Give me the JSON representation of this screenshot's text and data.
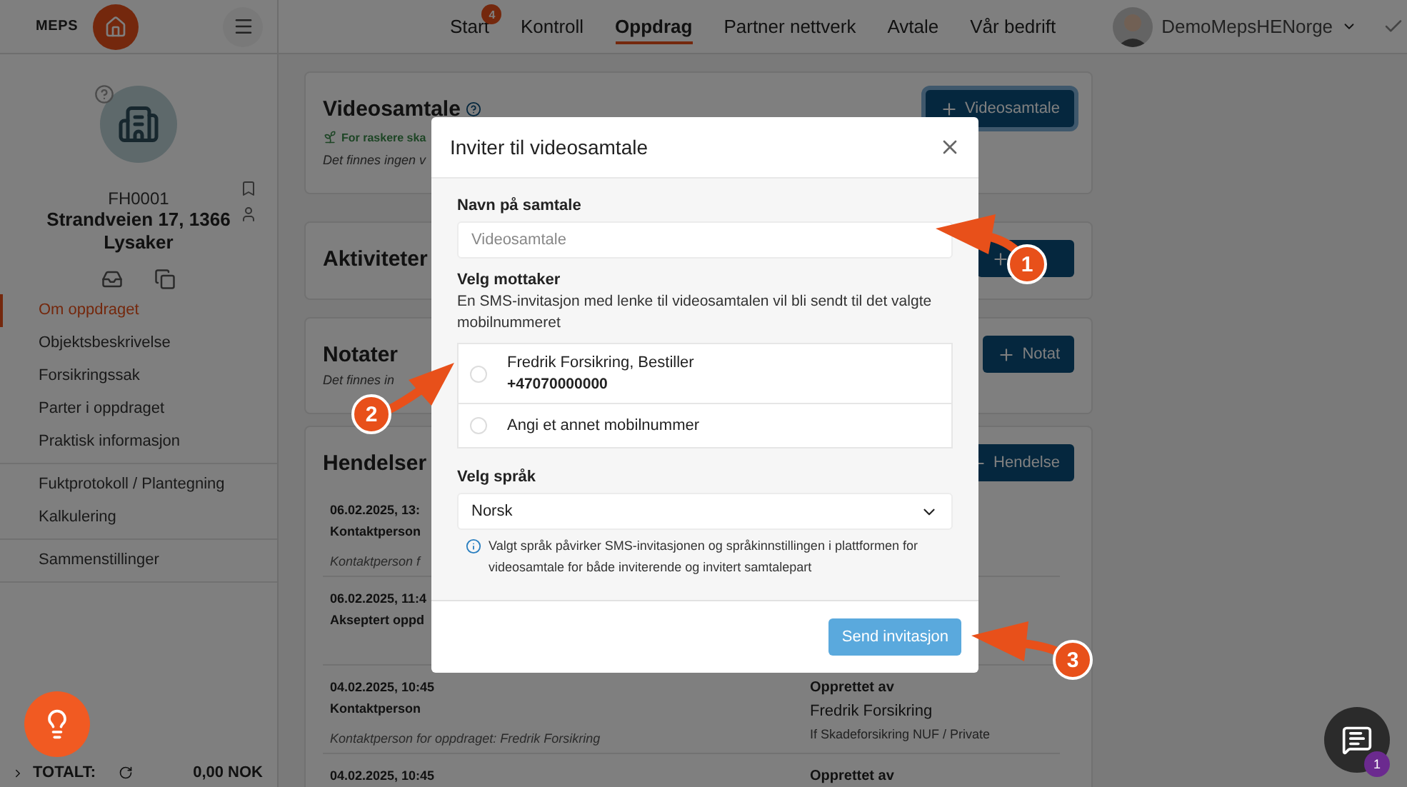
{
  "topbar": {
    "logo": "MEPS",
    "nav": [
      {
        "label": "Start",
        "badge": "4",
        "selected": false
      },
      {
        "label": "Kontroll",
        "selected": false
      },
      {
        "label": "Oppdrag",
        "selected": true
      },
      {
        "label": "Partner nettverk",
        "selected": false
      },
      {
        "label": "Avtale",
        "selected": false
      },
      {
        "label": "Vår bedrift",
        "selected": false
      }
    ],
    "user": "DemoMepsHENorge"
  },
  "sidebar": {
    "case_id": "FH0001",
    "address": "Strandveien 17, 1366 Lysaker",
    "menu_groups": [
      {
        "items": [
          {
            "label": "Om oppdraget",
            "selected": true
          },
          {
            "label": "Objektsbeskrivelse",
            "selected": false
          },
          {
            "label": "Forsikringssak",
            "selected": false
          },
          {
            "label": "Parter i oppdraget",
            "selected": false
          },
          {
            "label": "Praktisk informasjon",
            "selected": false
          }
        ]
      },
      {
        "items": [
          {
            "label": "Fuktprotokoll / Plantegning",
            "selected": false
          },
          {
            "label": "Kalkulering",
            "selected": false
          }
        ]
      },
      {
        "items": [
          {
            "label": "Sammenstillinger",
            "selected": false
          }
        ]
      }
    ],
    "total": {
      "label": "TOTALT:",
      "amount": "0,00 NOK"
    }
  },
  "video_card": {
    "title": "Videosamtale",
    "hint": "For raskere ska",
    "empty": "Det finnes ingen v",
    "button": "Videosamtale"
  },
  "activities_card": {
    "title": "Aktiviteter"
  },
  "notes_card": {
    "title": "Notater",
    "empty": "Det finnes in",
    "button": "Notat"
  },
  "events_card": {
    "title": "Hendelser",
    "button": "Hendelse",
    "events": [
      {
        "date": "06.02.2025, 13:",
        "title": "Kontaktperson",
        "note": "Kontaktperson f"
      },
      {
        "date": "06.02.2025, 11:4",
        "title": "Akseptert oppd"
      },
      {
        "date": "04.02.2025, 10:45",
        "title": "Kontaktperson",
        "note": "Kontaktperson for oppdraget: Fredrik Forsikring",
        "created_label": "Opprettet av",
        "created_name": "Fredrik Forsikring",
        "created_org": "If Skadeforsikring NUF / Private"
      },
      {
        "date": "04.02.2025, 10:45",
        "created_label": "Opprettet av"
      }
    ]
  },
  "modal": {
    "title": "Inviter til videosamtale",
    "name_label": "Navn på samtale",
    "name_placeholder": "Videosamtale",
    "recipient_label": "Velg mottaker",
    "recipient_help": "En SMS-invitasjon med lenke til videosamtalen vil bli sendt til det valgte mobilnummeret",
    "options": [
      {
        "label": "Fredrik Forsikring, Bestiller",
        "phone": "+47070000000",
        "selected": false
      },
      {
        "label": "Angi et annet mobilnummer",
        "selected": false
      }
    ],
    "language_label": "Velg språk",
    "language": "Norsk",
    "language_info": "Valgt språk påvirker SMS-invitasjonen og språkinnstillingen i plattformen for videosamtale for både inviterende og invitert samtalepart",
    "submit": "Send invitasjon"
  },
  "annotations": [
    "1",
    "2",
    "3"
  ],
  "chat": {
    "badge": "1"
  }
}
